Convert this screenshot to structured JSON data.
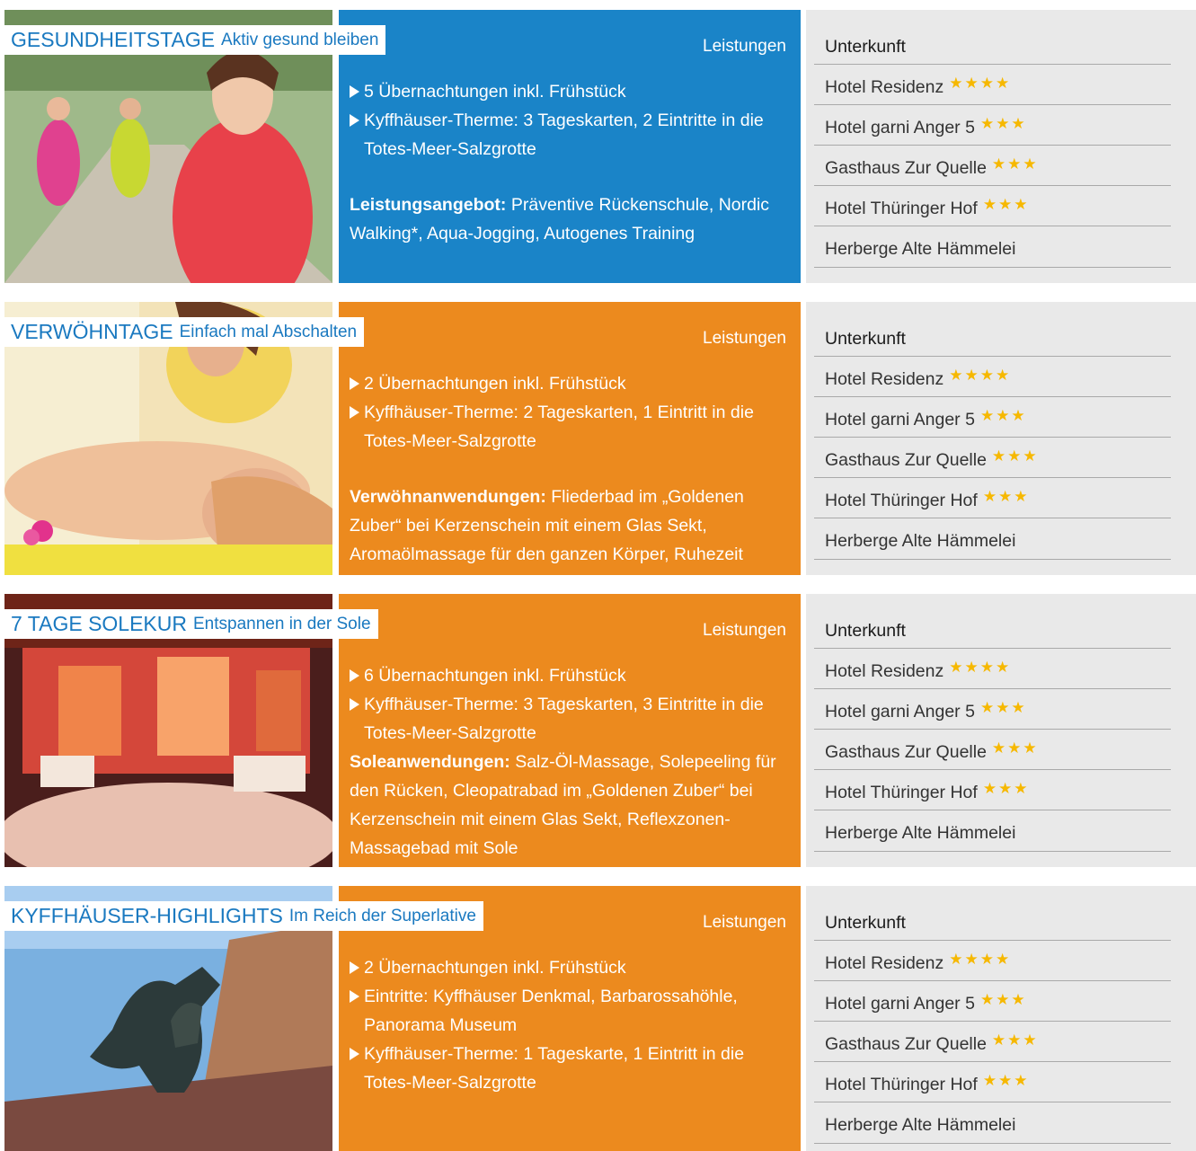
{
  "colors": {
    "title": "#1a79c0",
    "blue_panel": "#1a84c8",
    "orange_panel": "#ec8a1e",
    "lodging_panel": "#e9e9e9",
    "star": "#f6b800"
  },
  "packages": [
    {
      "title": "GESUNDHEITSTAGE",
      "subtitle": "Aktiv gesund bleiben",
      "services_heading": "Leistungen",
      "services": [
        "5 Übernachtungen inkl. Frühstück",
        "Kyffhäuser-Therme: 3 Tageskarten, 2 Eintritte in die Totes-Meer-Salzgrotte"
      ],
      "note_label": "Leistungsangebot:",
      "note_text": "Präventive Rückenschule, Nordic Walking*, Aqua-Jogging, Autogenes Training",
      "lodging_heading": "Unterkunft",
      "lodging": [
        {
          "name": "Hotel Residenz",
          "stars": "★★★★"
        },
        {
          "name": "Hotel garni Anger 5",
          "stars": "★★★"
        },
        {
          "name": "Gasthaus Zur Quelle",
          "stars": "★★★"
        },
        {
          "name": "Hotel Thüringer Hof",
          "stars": "★★★"
        },
        {
          "name": "Herberge Alte Hämmelei",
          "stars": ""
        }
      ]
    },
    {
      "title": "VERWÖHNTAGE",
      "subtitle": "Einfach mal Abschalten",
      "services_heading": "Leistungen",
      "services": [
        "2 Übernachtungen inkl. Frühstück",
        "Kyffhäuser-Therme: 2 Tageskarten, 1 Eintritt in die Totes-Meer-Salzgrotte"
      ],
      "note_label": "Verwöhnanwendungen:",
      "note_text": "Fliederbad im „Goldenen Zuber“ bei Kerzenschein mit einem Glas Sekt, Aromaölmassage für den ganzen Körper, Ruhezeit",
      "lodging_heading": "Unterkunft",
      "lodging": [
        {
          "name": "Hotel Residenz",
          "stars": "★★★★"
        },
        {
          "name": "Hotel garni Anger 5",
          "stars": "★★★"
        },
        {
          "name": "Gasthaus Zur Quelle",
          "stars": "★★★"
        },
        {
          "name": "Hotel Thüringer Hof",
          "stars": "★★★"
        },
        {
          "name": "Herberge Alte Hämmelei",
          "stars": ""
        }
      ]
    },
    {
      "title": "7 TAGE SOLEKUR",
      "subtitle": "Entspannen in der Sole",
      "services_heading": "Leistungen",
      "services": [
        "6 Übernachtungen inkl. Frühstück",
        "Kyffhäuser-Therme: 3 Tageskarten, 3 Eintritte in die Totes-Meer-Salzgrotte"
      ],
      "note_label": "Soleanwendungen:",
      "note_text": "Salz-Öl-Massage, Solepeeling für den Rücken, Cleopatrabad im „Goldenen Zuber“ bei Kerzenschein mit einem Glas Sekt, Reflexzonen-Massagebad mit Sole",
      "lodging_heading": "Unterkunft",
      "lodging": [
        {
          "name": "Hotel Residenz",
          "stars": "★★★★"
        },
        {
          "name": "Hotel garni Anger 5",
          "stars": "★★★"
        },
        {
          "name": "Gasthaus Zur Quelle",
          "stars": "★★★"
        },
        {
          "name": "Hotel Thüringer Hof",
          "stars": "★★★"
        },
        {
          "name": "Herberge Alte Hämmelei",
          "stars": ""
        }
      ]
    },
    {
      "title": "KYFFHÄUSER-HIGHLIGHTS",
      "subtitle": "Im Reich der Superlative",
      "services_heading": "Leistungen",
      "services": [
        "2 Übernachtungen inkl. Frühstück",
        "Eintritte: Kyffhäuser Denkmal, Barbarossahöhle, Panorama Museum",
        "Kyffhäuser-Therme: 1 Tageskarte, 1 Eintritt in die Totes-Meer-Salzgrotte"
      ],
      "lodging_heading": "Unterkunft",
      "lodging": [
        {
          "name": "Hotel Residenz",
          "stars": "★★★★"
        },
        {
          "name": "Hotel garni Anger 5",
          "stars": "★★★"
        },
        {
          "name": "Gasthaus Zur Quelle",
          "stars": "★★★"
        },
        {
          "name": "Hotel Thüringer Hof",
          "stars": "★★★"
        },
        {
          "name": "Herberge Alte Hämmelei",
          "stars": ""
        }
      ]
    }
  ]
}
